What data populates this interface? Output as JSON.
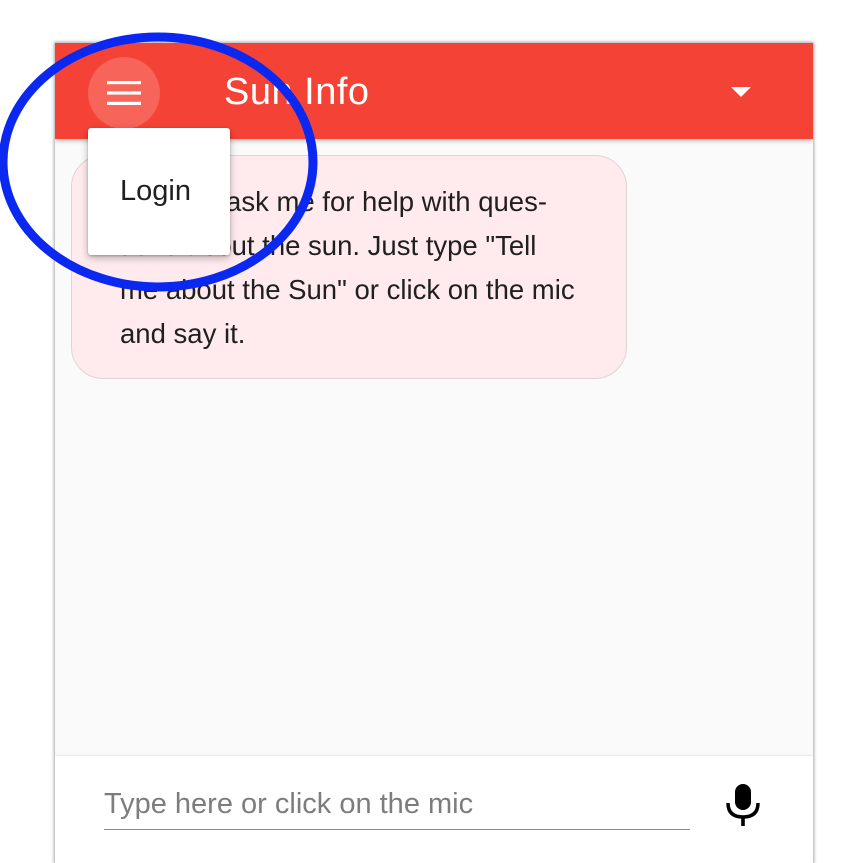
{
  "app": {
    "title": "Sun Info"
  },
  "header": {
    "menu_icon": "hamburger-menu-icon",
    "overflow_icon": "caret-down-icon"
  },
  "menu": {
    "items": [
      {
        "label": "Login"
      }
    ]
  },
  "chat": {
    "messages": [
      {
        "text": "You can ask me for help with ques-tions about the sun. Just type \"Tell me about the Sun\" or click on the mic and say it."
      }
    ]
  },
  "input": {
    "placeholder": "Type here or click on the mic",
    "value": "",
    "mic_icon": "microphone-icon"
  },
  "colors": {
    "app_bar": "#f44336",
    "bubble_background": "#ffebee",
    "annotation_circle": "#0a28f0"
  }
}
